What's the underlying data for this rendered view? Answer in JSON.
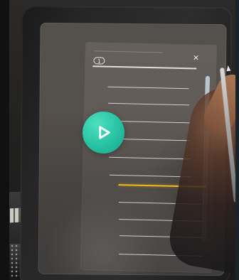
{
  "panel": {
    "index_badge": "1",
    "close_symbol": "×"
  },
  "icons": {
    "close": "close-icon",
    "play": "play-icon",
    "scroll": "scrollbar"
  },
  "colors": {
    "accent": "#2dc6a7",
    "active_line": "#f2b81f",
    "scroll_track": "#cfd6de"
  },
  "list": {
    "rows": 11,
    "active_row": 7
  },
  "scroll": {
    "position": 0.12
  }
}
